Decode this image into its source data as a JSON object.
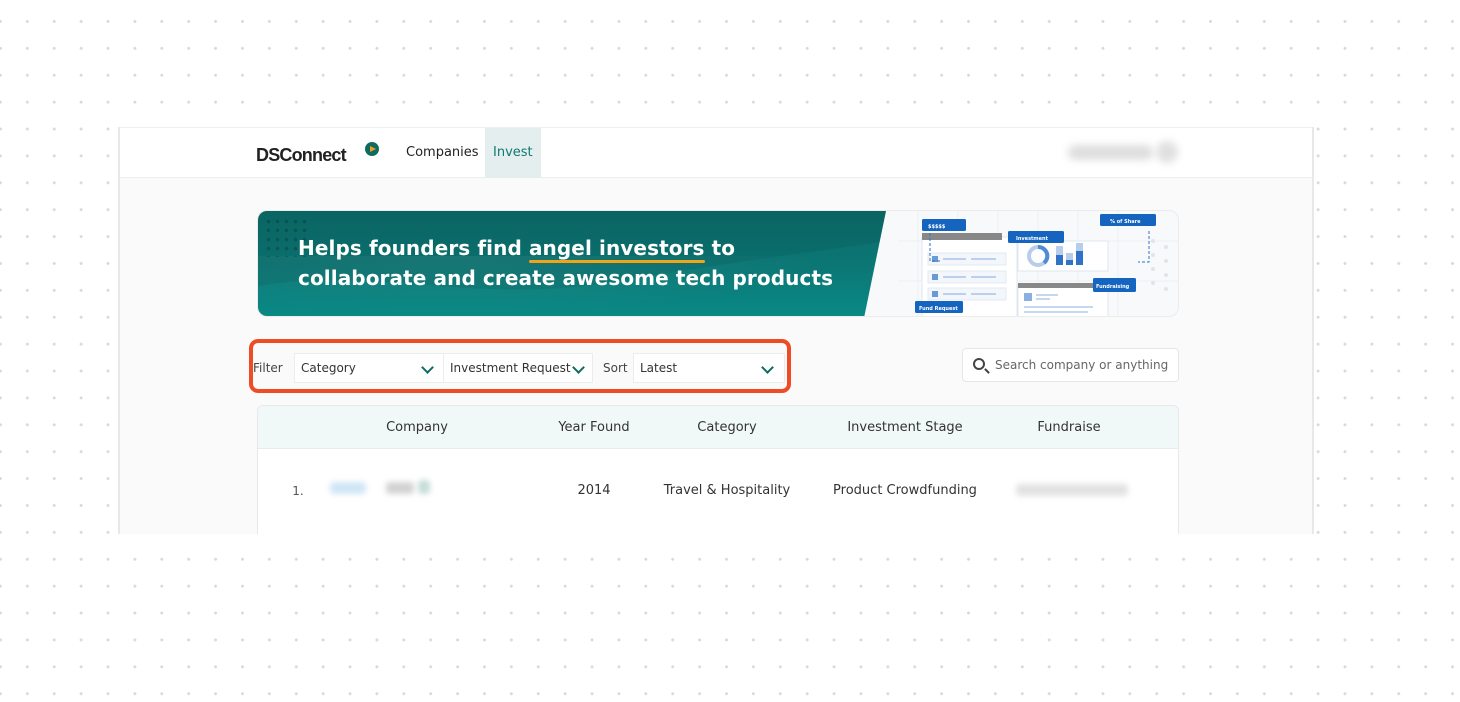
{
  "header": {
    "logo_text": "DSConnect",
    "nav": [
      {
        "label": "Companies",
        "active": false
      },
      {
        "label": "Invest",
        "active": true
      }
    ],
    "user_name": "[redacted]"
  },
  "banner": {
    "text_before": "Helps founders find ",
    "text_highlight": "angel investors",
    "text_after_line1": " to",
    "text_line2": "collaborate and create awesome tech products",
    "illustration_labels": {
      "amount": "$$$$$",
      "investment": "Investment",
      "share": "% of Share",
      "fundraising": "Fundraising",
      "fund_request": "Fund Request"
    }
  },
  "filters": {
    "filter_label": "Filter",
    "category": {
      "value": "Category"
    },
    "investment_request": {
      "value": "Investment Request"
    },
    "sort_label": "Sort",
    "sort": {
      "value": "Latest"
    }
  },
  "search": {
    "placeholder": "Search company or anything",
    "value": ""
  },
  "table": {
    "columns": [
      "Company",
      "Year Found",
      "Category",
      "Investment Stage",
      "Fundraise"
    ],
    "rows": [
      {
        "index": "1.",
        "company": "[redacted]",
        "year_found": "2014",
        "category": "Travel & Hospitality",
        "investment_stage": "Product Crowdfunding",
        "fundraise": "[redacted]"
      }
    ]
  },
  "colors": {
    "brand_teal": "#0f6b62",
    "highlight_outline": "#ef4b24",
    "underline_accent": "#f0a418"
  }
}
